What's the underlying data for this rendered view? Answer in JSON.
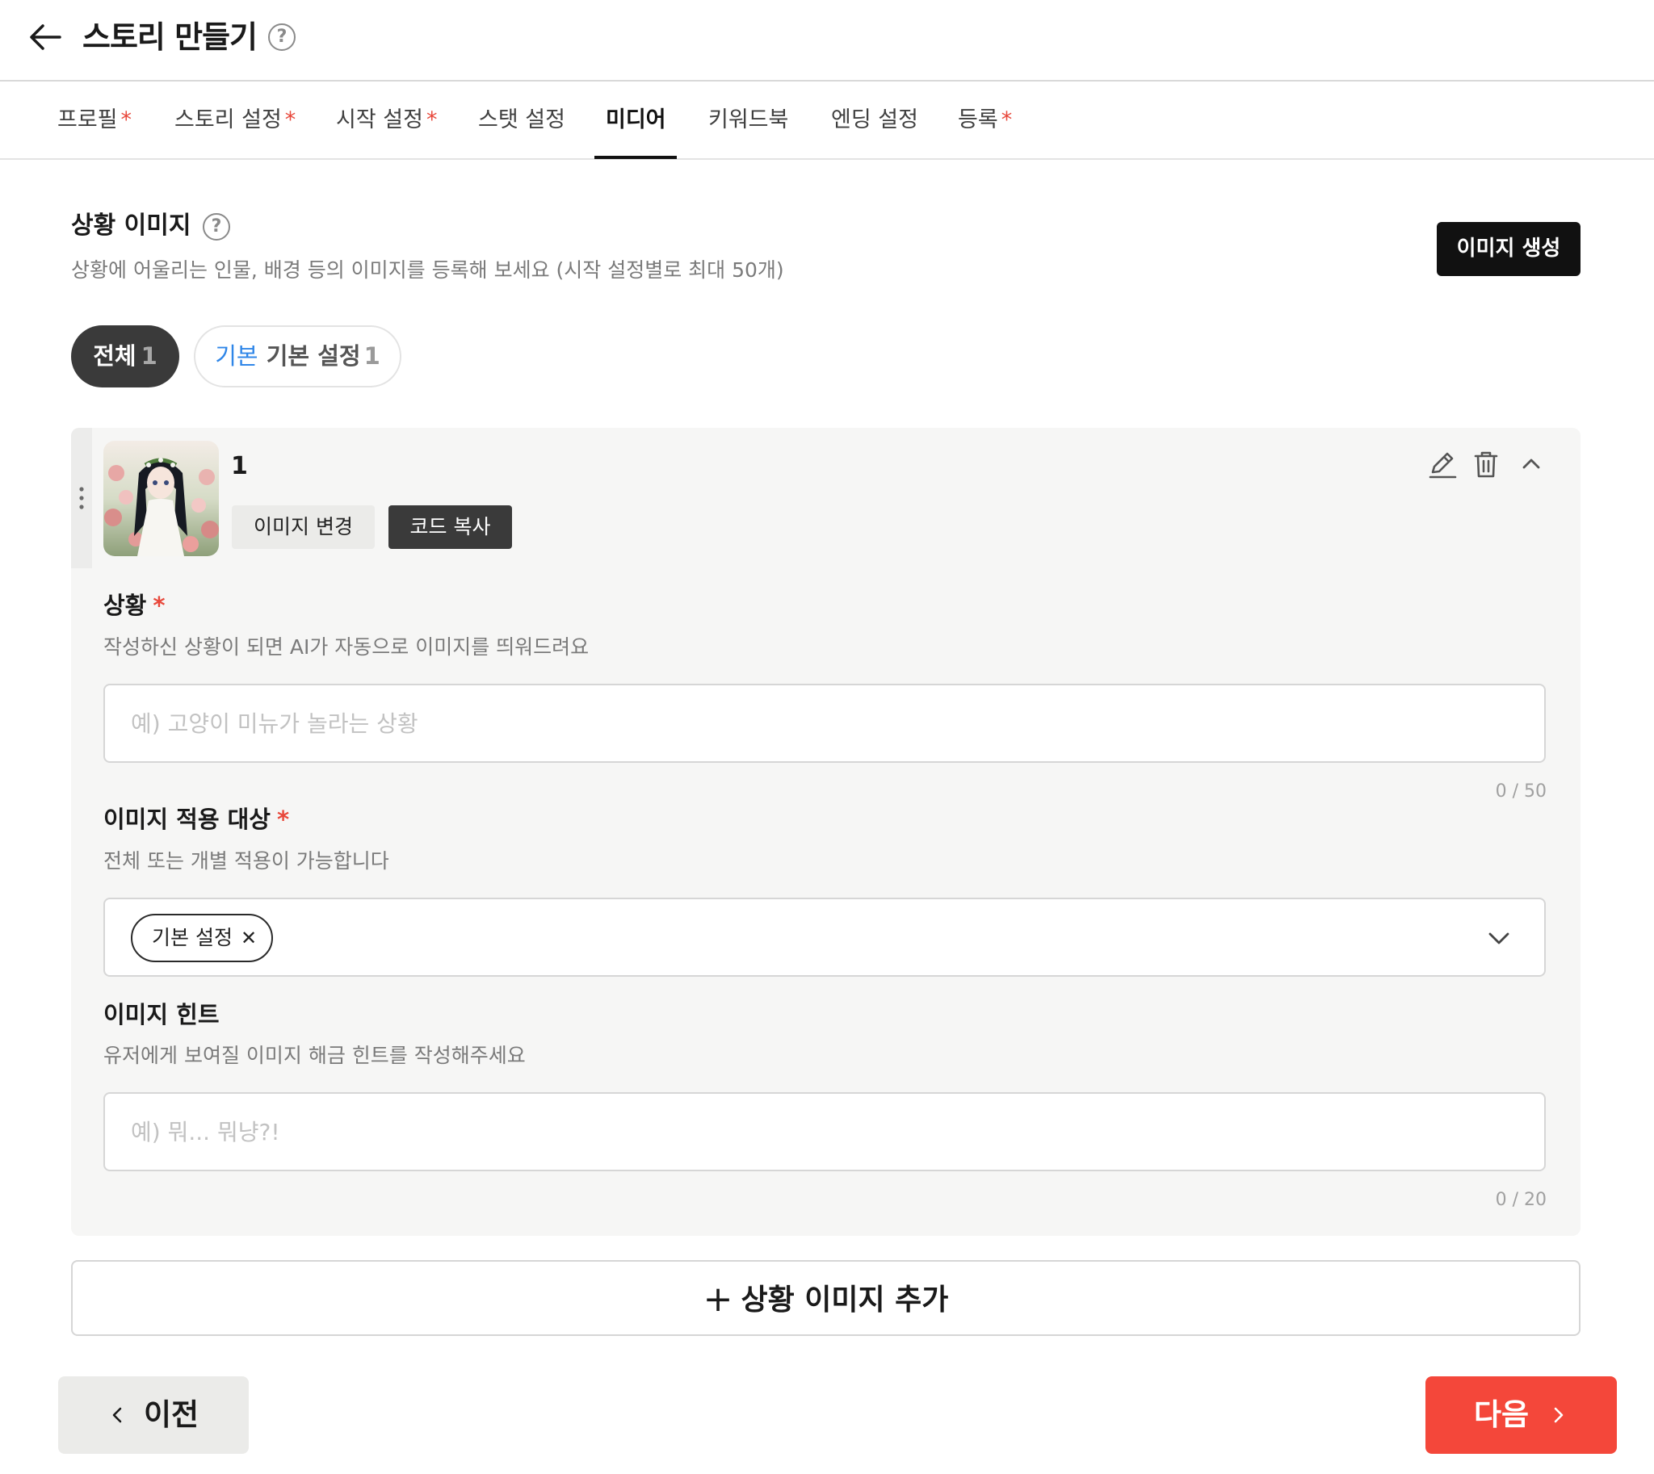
{
  "header": {
    "title": "스토리 만들기",
    "help_glyph": "?",
    "back_icon": "arrow-left-icon"
  },
  "tabs": [
    {
      "label": "프로필",
      "required": true,
      "required_mark": "*"
    },
    {
      "label": "스토리 설정",
      "required": true,
      "required_mark": "*"
    },
    {
      "label": "시작 설정",
      "required": true,
      "required_mark": "*"
    },
    {
      "label": "스탯 설정",
      "required": false
    },
    {
      "label": "미디어",
      "required": false,
      "active": true
    },
    {
      "label": "키워드북",
      "required": false
    },
    {
      "label": "엔딩 설정",
      "required": false
    },
    {
      "label": "등록",
      "required": true,
      "required_mark": "*"
    }
  ],
  "section": {
    "title": "상황 이미지",
    "help_glyph": "?",
    "description": "상황에 어울리는 인물, 배경 등의 이미지를 등록해 보세요 (시작 설정별로 최대 50개)",
    "generate_button": "이미지 생성"
  },
  "filters": {
    "all": {
      "label": "전체",
      "count": "1"
    },
    "basic": {
      "prefix": "기본",
      "label": "기본 설정",
      "count": "1"
    }
  },
  "item": {
    "number": "1",
    "change_image_button": "이미지 변경",
    "copy_code_button": "코드 복사",
    "drag_glyph": "⋮",
    "icons": [
      "pencil-icon",
      "trash-icon",
      "chevron-up-icon"
    ]
  },
  "situation": {
    "label": "상황",
    "required_mark": "*",
    "description": "작성하신 상황이 되면 AI가 자동으로 이미지를 띄워드려요",
    "value": "",
    "placeholder": "예) 고양이 미뉴가 놀라는 상황",
    "counter": "0 / 50"
  },
  "target": {
    "label": "이미지 적용 대상",
    "required_mark": "*",
    "description": "전체 또는 개별 적용이 가능합니다",
    "selected_tag": "기본 설정",
    "remove_glyph": "✕"
  },
  "hint": {
    "label": "이미지 힌트",
    "description": "유저에게 보여질 이미지 해금 힌트를 작성해주세요",
    "value": "",
    "placeholder": "예) 뭐... 뭐냥?!",
    "counter": "0 / 20"
  },
  "add_button": {
    "plus": "+",
    "label": "상황 이미지 추가"
  },
  "footer": {
    "prev_label": "이전",
    "next_label": "다음"
  },
  "colors": {
    "accent_red": "#f4473a",
    "required_red": "#e8483b",
    "link_blue": "#2f86e8",
    "dark": "#111111",
    "card_bg": "#f6f6f5"
  }
}
